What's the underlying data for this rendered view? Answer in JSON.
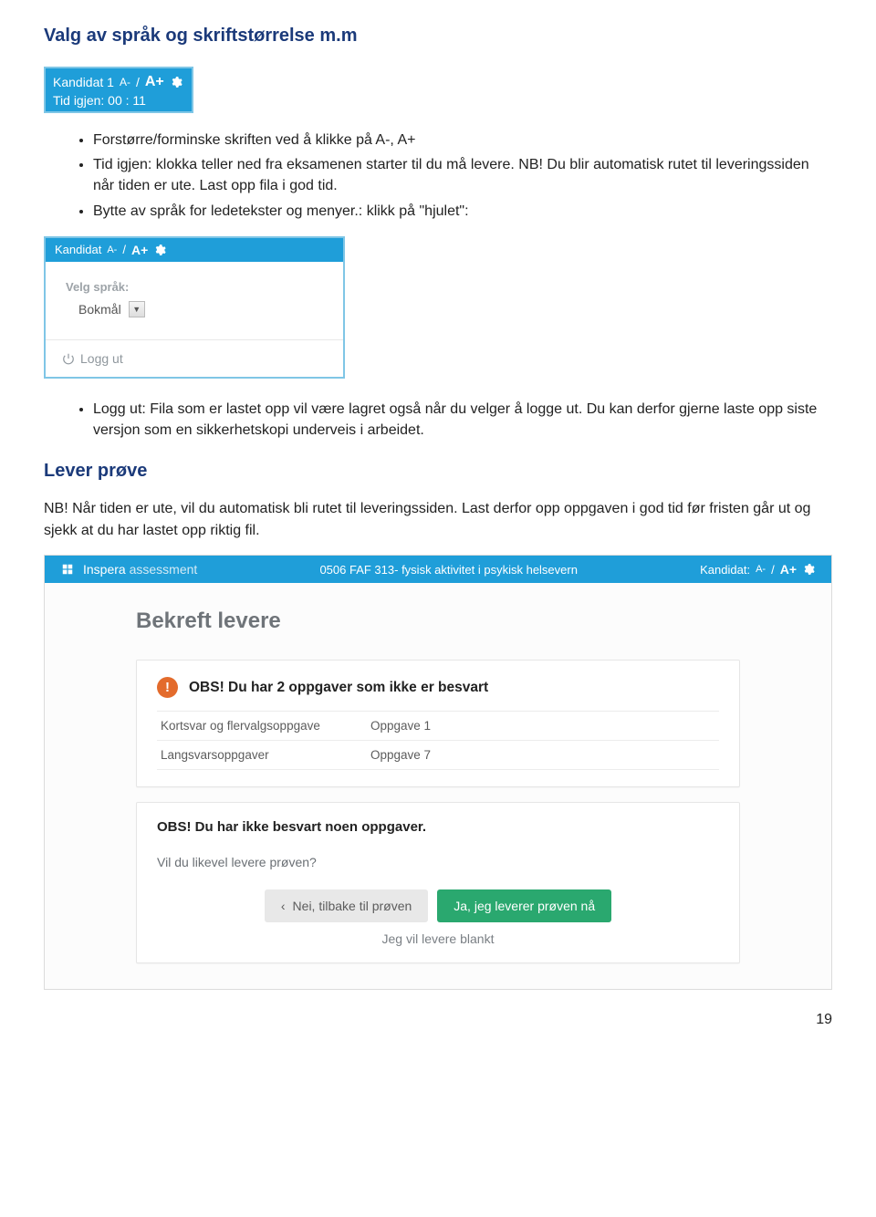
{
  "headings": {
    "h1": "Valg av språk og skriftstørrelse m.m",
    "h2": "Lever prøve"
  },
  "kandidatBox": {
    "label": "Kandidat 1",
    "aMinus": "A-",
    "slash": "/",
    "aPlus": "A+",
    "timeLabel": "Tid igjen: 00 : 11"
  },
  "bulletsTop": [
    "Forstørre/forminske skriften ved å klikke på A-, A+",
    "Tid igjen: klokka teller ned fra eksamenen starter til du må levere. NB! Du blir automatisk rutet til leveringssiden når tiden er ute. Last opp fila i god tid.",
    "Bytte av språk for ledetekster og menyer.: klikk på \"hjulet\":"
  ],
  "langPanel": {
    "hdrKandidat": "Kandidat",
    "hdrAminus": "A-",
    "hdrSlash": "/",
    "hdrAplus": "A+",
    "velgLabel": "Velg språk:",
    "selected": "Bokmål",
    "logout": "Logg ut"
  },
  "bulletsBottom": [
    "Logg ut: Fila som er lastet opp vil være lagret også når du velger å logge ut. Du kan derfor gjerne laste opp siste versjon som en sikkerhetskopi underveis i arbeidet."
  ],
  "para1": "NB! Når tiden er ute, vil du automatisk bli rutet til leveringssiden. Last derfor opp oppgaven i god tid før fristen går ut og sjekk at du har lastet opp riktig fil.",
  "inspera": {
    "brand1": "Inspera",
    "brand2": "assessment",
    "center": "0506 FAF 313- fysisk aktivitet i psykisk helsevern",
    "rightLabel": "Kandidat:",
    "aMinus": "A-",
    "slash": "/",
    "aPlus": "A+",
    "bekreftTitle": "Bekreft levere",
    "alertText": "OBS! Du har 2 oppgaver som ikke er besvart",
    "taskRows": [
      {
        "c1": "Kortsvar og flervalgsoppgave",
        "c2": "Oppgave 1"
      },
      {
        "c1": "Langsvarsoppgaver",
        "c2": "Oppgave 7"
      }
    ],
    "obs2": "OBS! Du har ikke besvart noen oppgaver.",
    "question": "Vil du likevel levere prøven?",
    "btnBack": "Nei, tilbake til prøven",
    "btnPrimary": "Ja, jeg leverer prøven nå",
    "blank": "Jeg vil levere blankt"
  },
  "pageNumber": "19",
  "glyphs": {
    "exclaim": "!",
    "chevLeft": "‹",
    "chevDown": "▼"
  }
}
